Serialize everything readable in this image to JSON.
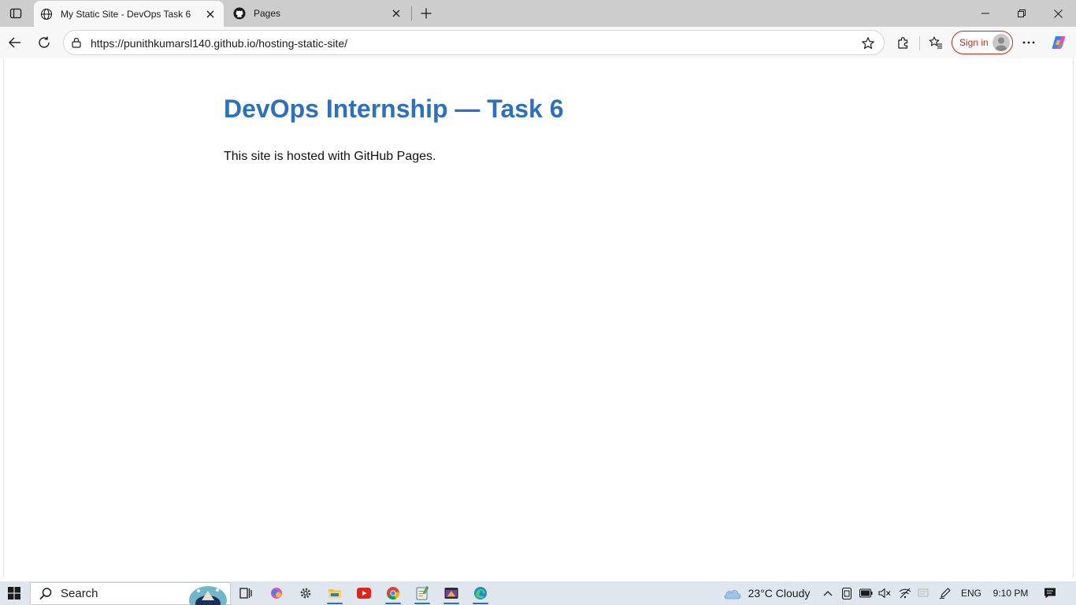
{
  "browser": {
    "tabs": [
      {
        "title": "My Static Site - DevOps Task 6",
        "favicon": "globe-icon",
        "active": true
      },
      {
        "title": "Pages",
        "favicon": "github-icon",
        "active": false
      }
    ],
    "address_bar": {
      "url": "https://punithkumarsl140.github.io/hosting-static-site/"
    },
    "sign_in_label": "Sign in"
  },
  "page": {
    "heading": "DevOps Internship — Task 6",
    "body": "This site is hosted with GitHub Pages."
  },
  "taskbar": {
    "search_label": "Search",
    "weather": "23°C  Cloudy",
    "language": "ENG",
    "time": "9:10 PM"
  },
  "colors": {
    "heading": "#2d6fc0",
    "signin_accent": "#c42b1c",
    "taskbar_bg": "#dfe6ee",
    "tabstrip_bg": "#cdcdcd"
  }
}
